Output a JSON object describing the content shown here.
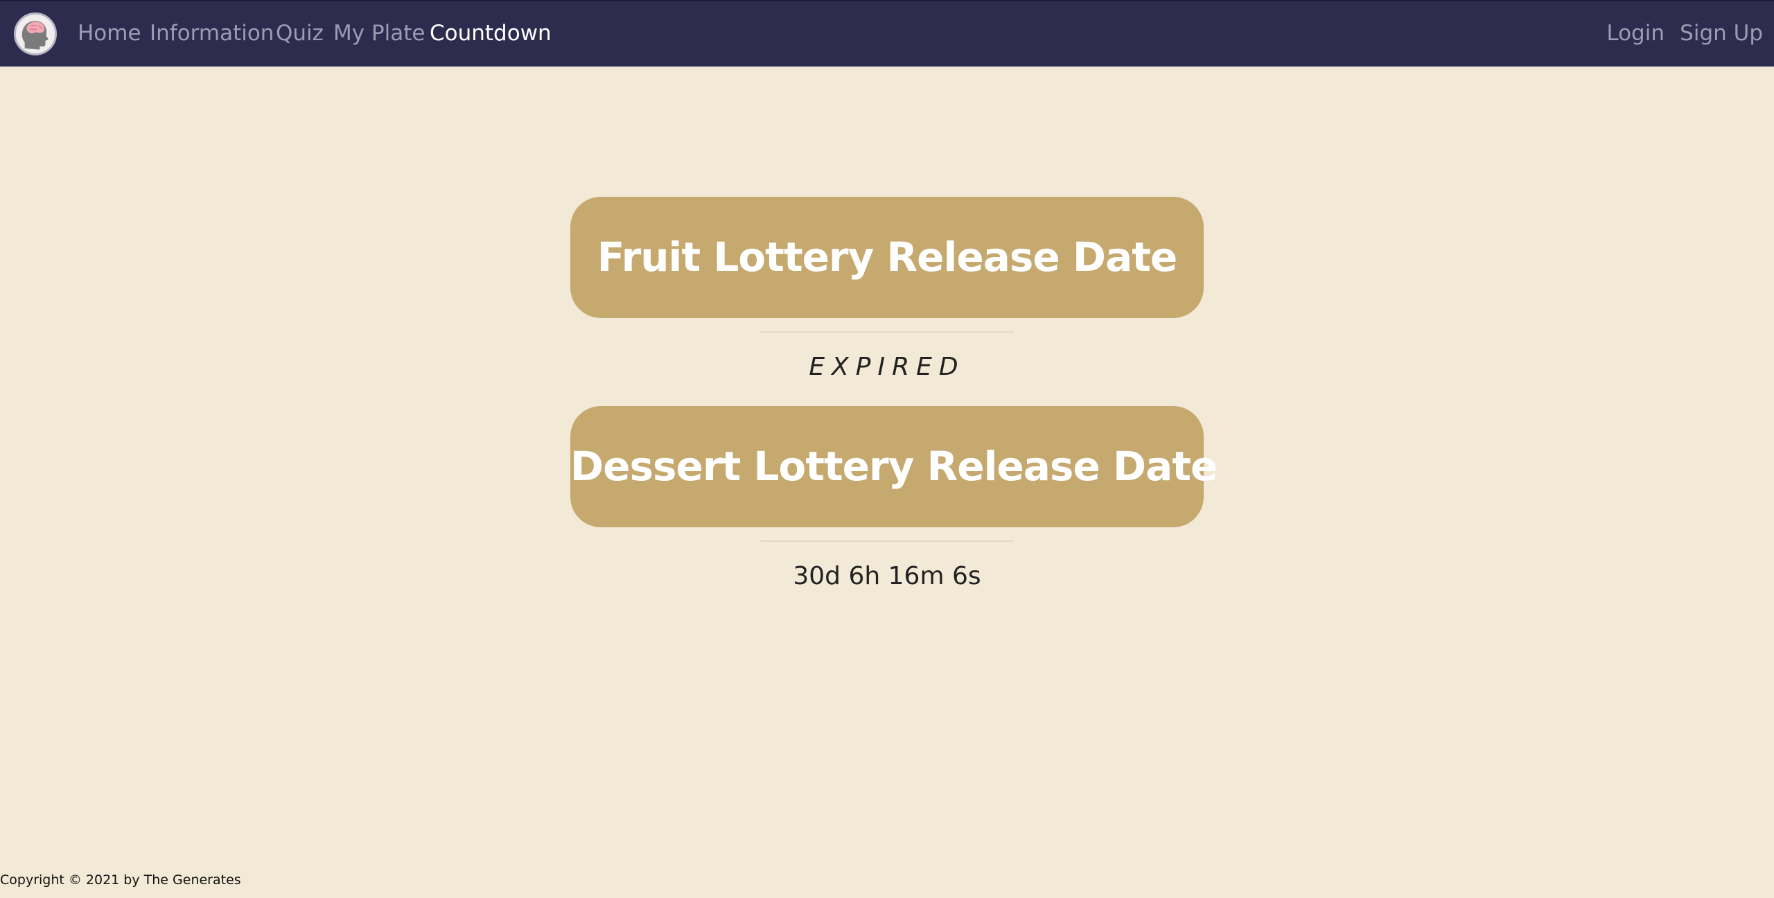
{
  "nav": {
    "links": [
      {
        "label": "Home"
      },
      {
        "label": "Information"
      },
      {
        "label": "Quiz"
      },
      {
        "label": "My Plate"
      },
      {
        "label": "Countdown"
      }
    ],
    "active": "Countdown",
    "login_label": "Login",
    "signup_label": "Sign Up",
    "logo_icon": "brain-head-icon"
  },
  "main": {
    "fruit": {
      "button_label": "Fruit Lottery Release Date",
      "status": "EXPIRED"
    },
    "dessert": {
      "button_label": "Dessert Lottery Release Date",
      "status": "30d 6h 16m 6s"
    }
  },
  "footer": {
    "copyright": "Copyright © 2021 by The Generates"
  },
  "colors": {
    "navbar_bg": "#2d2b4e",
    "page_bg": "#f3e9d7",
    "button_bg": "#c5a96f",
    "button_text": "#ffffff",
    "nav_link": "#9c9cb2",
    "nav_active": "#ffffff"
  }
}
